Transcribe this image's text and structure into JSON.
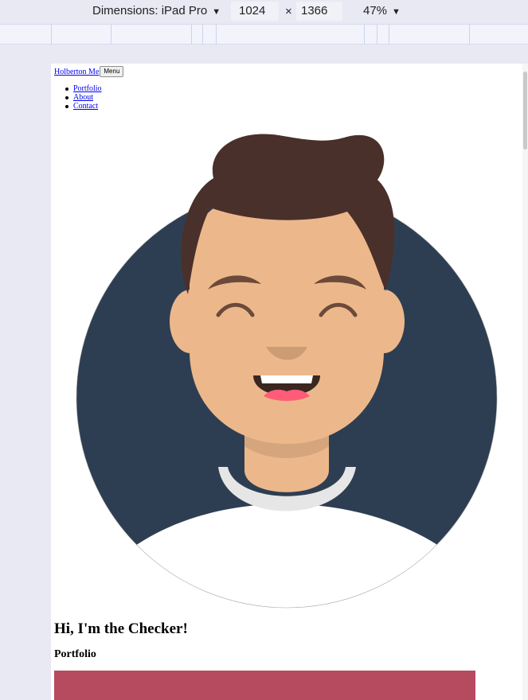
{
  "devtools": {
    "dimensions_label": "Dimensions: iPad Pro",
    "width": "1024",
    "times": "×",
    "height": "1366",
    "zoom": "47%",
    "caret": "▼"
  },
  "page": {
    "nav": {
      "brand": "Holberton Me",
      "menu_button": "Menu",
      "links": [
        "Portfolio",
        "About",
        "Contact"
      ]
    },
    "hero_title": "Hi, I'm the Checker!",
    "section_title": "Portfolio"
  },
  "colors": {
    "avatar_background": "#2e3e52",
    "skin": "#ecb88b",
    "hair": "#4a302a",
    "portfolio_card": "#b64b5f"
  }
}
